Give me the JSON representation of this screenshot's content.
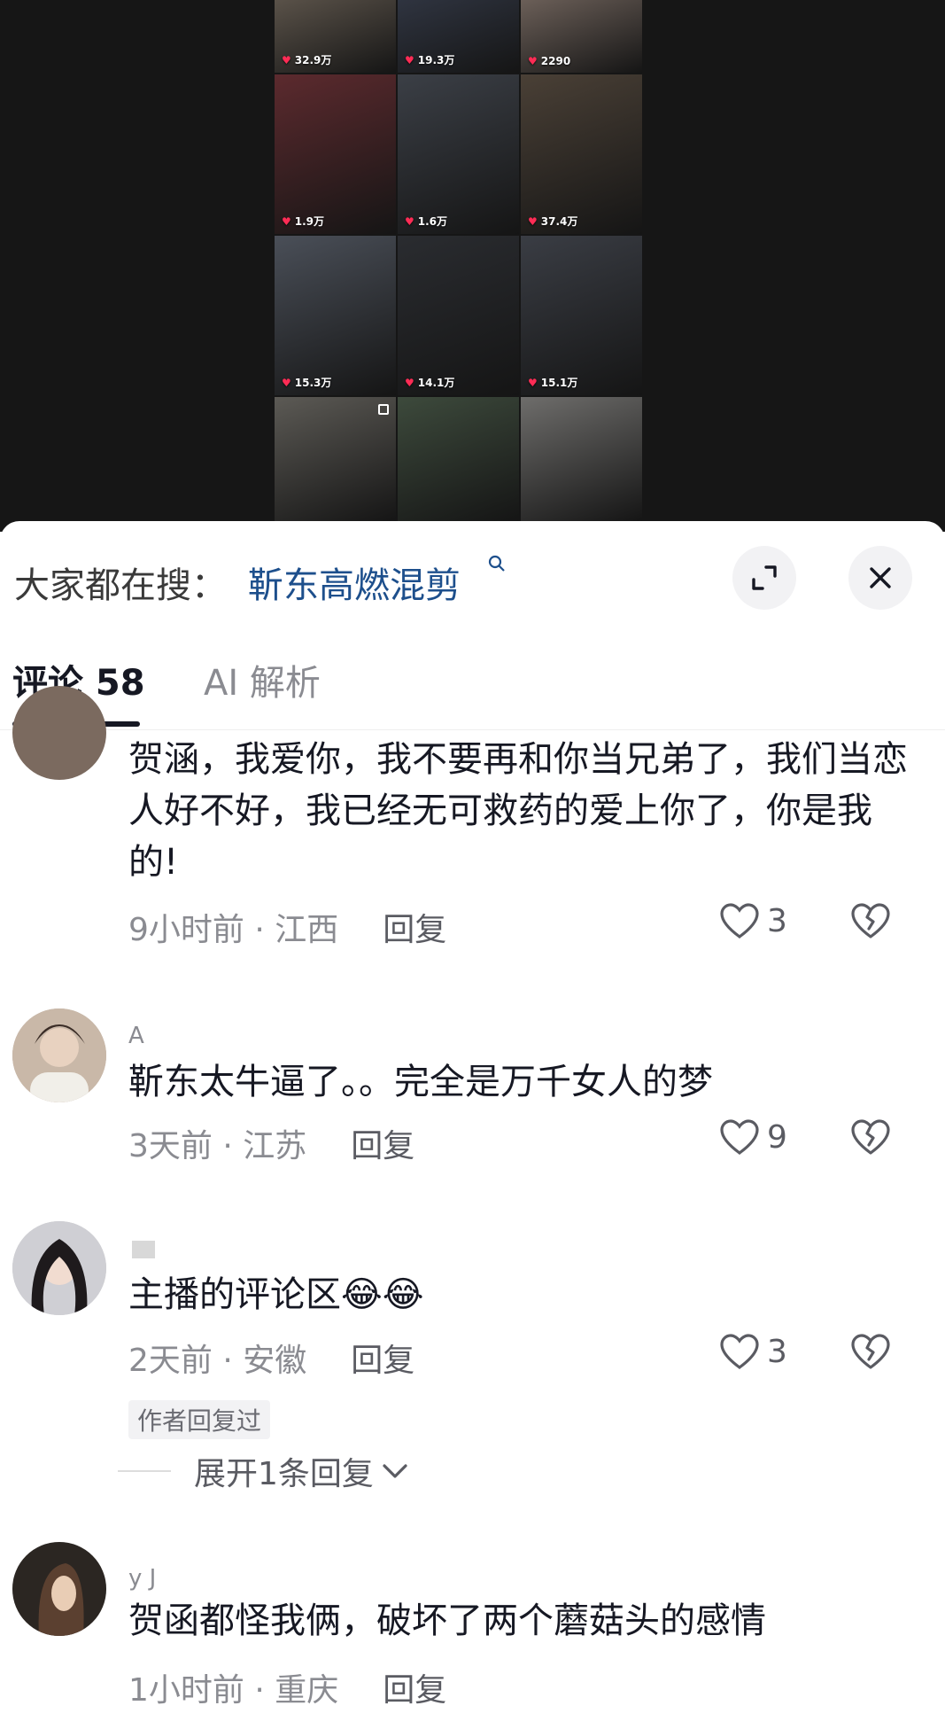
{
  "video_grid": {
    "tiles": [
      {
        "likes": "32.9万",
        "shade": "#5a5249"
      },
      {
        "likes": "19.3万",
        "shade": "#2f3440"
      },
      {
        "likes": "2290",
        "shade": "#6b5f58"
      },
      {
        "likes": "1.9万",
        "shade": "#5c2a2e"
      },
      {
        "likes": "1.6万",
        "shade": "#3b3f46"
      },
      {
        "likes": "37.4万",
        "shade": "#4a4036"
      },
      {
        "likes": "15.3万",
        "shade": "#4a4f58"
      },
      {
        "likes": "14.1万",
        "shade": "#2a2c30"
      },
      {
        "likes": "15.1万",
        "shade": "#3a3d44"
      },
      {
        "likes": "",
        "shade": "#5c5a55"
      },
      {
        "likes": "",
        "shade": "#3d4a3c"
      },
      {
        "likes": "",
        "shade": "#6e6d6b"
      }
    ]
  },
  "search": {
    "prefix": "大家都在搜：",
    "term": "靳东高燃混剪",
    "icon": "search-icon"
  },
  "tabs": {
    "comments_label": "评论 58",
    "ai_label": "AI 解析"
  },
  "comments": [
    {
      "text": "贺涵，我爱你，我不要再和你当兄弟了，我们当恋人好不好，我已经无可救药的爱上你了，你是我的!",
      "time": "9小时前 · 江西",
      "reply": "回复",
      "likes": "3"
    },
    {
      "user": "A",
      "text": "靳东太牛逼了。。完全是万千女人的梦",
      "time": "3天前 · 江苏",
      "reply": "回复",
      "likes": "9"
    },
    {
      "text": "主播的评论区😂😂",
      "time": "2天前 · 安徽",
      "reply": "回复",
      "likes": "3",
      "author_badge": "作者回复过",
      "expand": "展开1条回复"
    },
    {
      "user": "y J",
      "text": "贺函都怪我俩，破坏了两个蘑菇头的感情",
      "time": "1小时前 · 重庆",
      "reply": "回复"
    }
  ],
  "colors": {
    "accent_link": "#1d4f8c",
    "like_heart": "#fe2c55"
  }
}
